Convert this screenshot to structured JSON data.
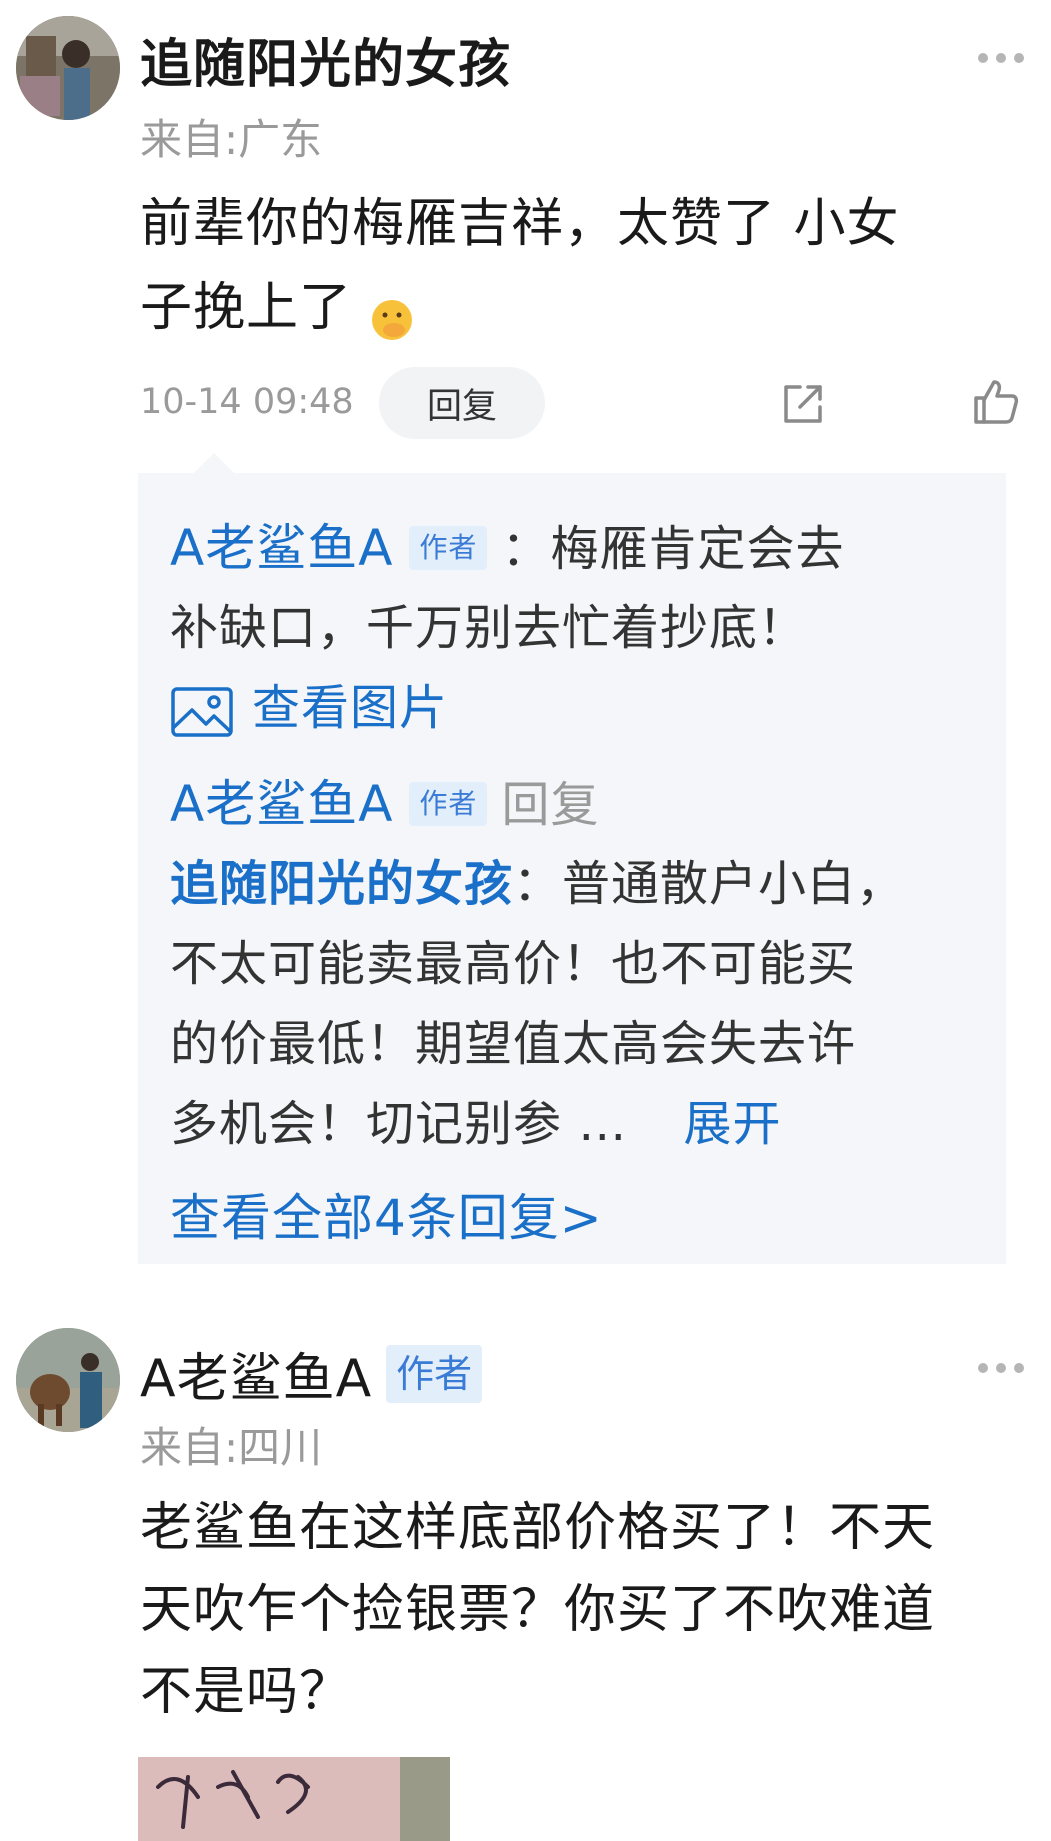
{
  "comments": [
    {
      "username": "追随阳光的女孩",
      "location": "来自:广东",
      "text_lines": [
        "前辈你的梅雁吉祥，太赞了 小女",
        "子挽上了"
      ],
      "time": "10-14 09:48",
      "reply_label": "回复",
      "icons": [
        "more-icon",
        "share-icon",
        "like-icon",
        "emoji-covering-mouth-icon"
      ],
      "replies": {
        "first": {
          "author": "A老鲨鱼A",
          "tag": "作者",
          "text_line1": "：梅雁肯定会去",
          "text_line2": "补缺口，千万别去忙着抄底！",
          "view_image": "查看图片"
        },
        "second": {
          "author": "A老鲨鱼A",
          "tag": "作者",
          "reply_word": "回复",
          "target": "追随阳光的女孩",
          "text_line1": "：普通散户小白，",
          "text_line2": "不太可能卖最高价！也不可能买",
          "text_line3": "的价最低！期望值太高会失去许",
          "text_line4": "多机会！切记别参 …",
          "expand": "展开"
        },
        "view_all": "查看全部4条回复>"
      }
    },
    {
      "username": "A老鲨鱼A",
      "tag": "作者",
      "location": "来自:四川",
      "text_lines": [
        "老鲨鱼在这样底部价格买了！不天",
        "天吹乍个捡银票？你买了不吹难道",
        "不是吗？"
      ]
    }
  ]
}
